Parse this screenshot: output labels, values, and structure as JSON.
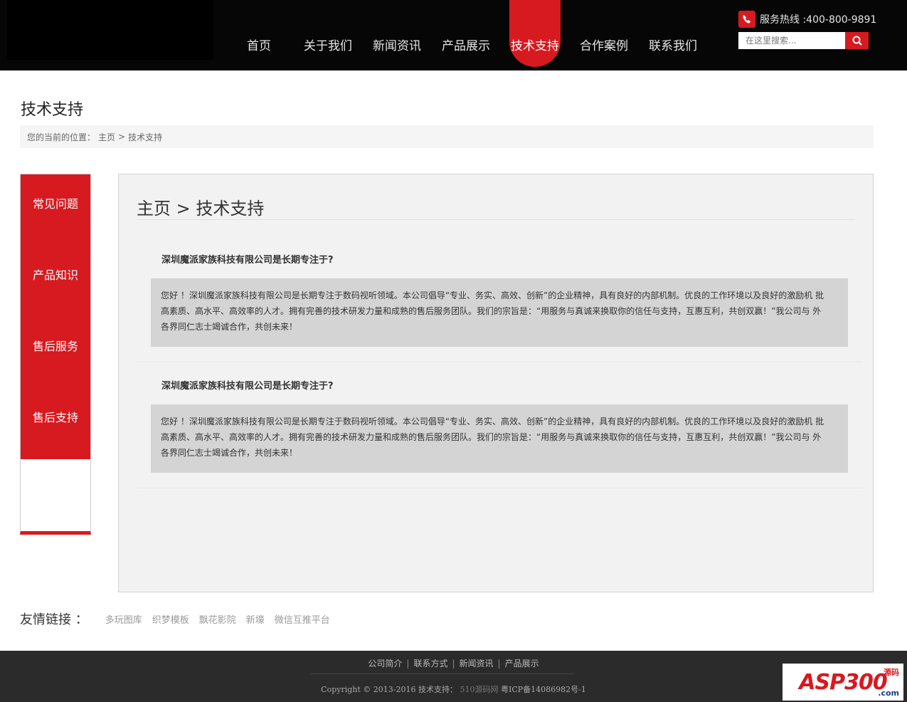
{
  "header": {
    "nav": [
      {
        "label": "首页",
        "active": false
      },
      {
        "label": "关于我们",
        "active": false
      },
      {
        "label": "新闻资讯",
        "active": false
      },
      {
        "label": "产品展示",
        "active": false
      },
      {
        "label": "技术支持",
        "active": true
      },
      {
        "label": "合作案例",
        "active": false
      },
      {
        "label": "联系我们",
        "active": false
      }
    ],
    "hotline": "服务热线 :400-800-9891",
    "search_placeholder": "在这里搜索...",
    "accent_color": "#d71920"
  },
  "page": {
    "title": "技术支持",
    "breadcrumb": {
      "prefix": "您的当前的位置：",
      "home": "主页",
      "separator": ">",
      "current": "技术支持"
    }
  },
  "sidebar": {
    "items": [
      {
        "label": "常见问题"
      },
      {
        "label": "产品知识"
      },
      {
        "label": "售后服务"
      },
      {
        "label": "售后支持"
      }
    ]
  },
  "main": {
    "heading": "主页 > 技术支持",
    "faqs": [
      {
        "question": "深圳魔派家族科技有限公司是长期专注于?",
        "answer_lines": [
          "您好 ！深圳魔派家族科技有限公司是长期专注于数码视听领域。本公司倡导“专业、务实、高效、创新”的企业精神，具有良好的内部机制。优良的工作环境以及良好的激励机 批",
          "高素质、高水平、高效率的人才。拥有完善的技术研发力量和成熟的售后服务团队。我们的宗旨是：“用服务与真诚来换取你的信任与支持，互惠互利，共创双赢！”我公司与 外",
          "各界同仁志士竭诚合作，共创未来！"
        ]
      },
      {
        "question": "深圳魔派家族科技有限公司是长期专注于?",
        "answer_lines": [
          "您好 ！深圳魔派家族科技有限公司是长期专注于数码视听领域。本公司倡导“专业、务实、高效、创新”的企业精神，具有良好的内部机制。优良的工作环境以及良好的激励机 批",
          "高素质、高水平、高效率的人才。拥有完善的技术研发力量和成熟的售后服务团队。我们的宗旨是：“用服务与真诚来换取你的信任与支持，互惠互利，共创双赢！”我公司与 外",
          "各界同仁志士竭诚合作，共创未来！"
        ]
      }
    ]
  },
  "links": {
    "label": "友情链接 ：",
    "items": [
      "多玩图库",
      "织梦模板",
      "飘花影院",
      "新壕",
      "微信互推平台"
    ]
  },
  "footer": {
    "nav": [
      "公司简介",
      "联系方式",
      "新闻资讯",
      "产品展示"
    ],
    "separator": "|",
    "copyright": "Copyright © 2013-2016 技术支持：",
    "support_link": "510源码网",
    "icp": "粤ICP备14086982号-1"
  },
  "watermark": {
    "text": "ASP300",
    "sub": "源码",
    "domain": ".com"
  }
}
